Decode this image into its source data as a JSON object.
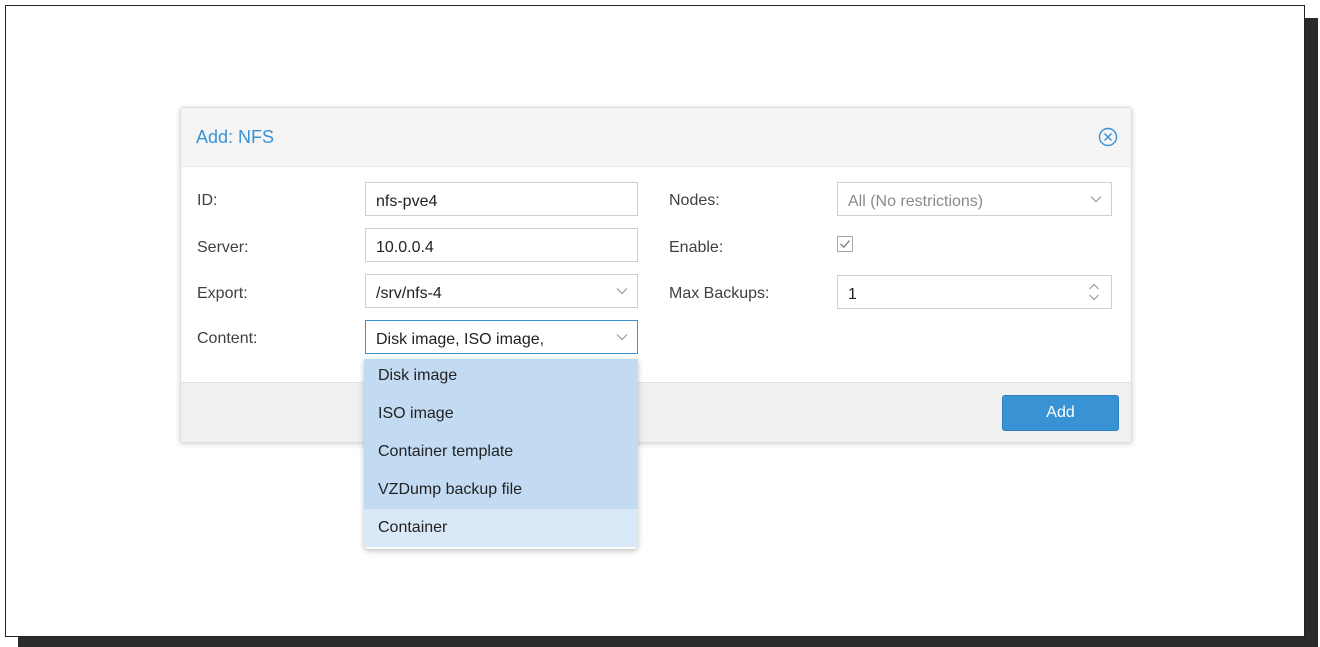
{
  "dialog": {
    "title": "Add: NFS",
    "close_icon": "close-circle-icon"
  },
  "form": {
    "id": {
      "label": "ID:",
      "value": "nfs-pve4"
    },
    "server": {
      "label": "Server:",
      "value": "10.0.0.4"
    },
    "export": {
      "label": "Export:",
      "value": "/srv/nfs-4"
    },
    "content": {
      "label": "Content:",
      "value": "Disk image, ISO image,"
    },
    "nodes": {
      "label": "Nodes:",
      "placeholder": "All (No restrictions)"
    },
    "enable": {
      "label": "Enable:",
      "checked": true
    },
    "max_backups": {
      "label": "Max Backups:",
      "value": "1"
    }
  },
  "content_dropdown": {
    "items": [
      {
        "label": "Disk image",
        "selected": true
      },
      {
        "label": "ISO image",
        "selected": true
      },
      {
        "label": "Container template",
        "selected": true
      },
      {
        "label": "VZDump backup file",
        "selected": true
      },
      {
        "label": "Container",
        "selected": false,
        "hovered": true
      }
    ]
  },
  "footer": {
    "add_label": "Add"
  },
  "colors": {
    "accent": "#3892d4",
    "selected_item": "#c2dbf2",
    "hover_item": "#d9e8f6"
  }
}
